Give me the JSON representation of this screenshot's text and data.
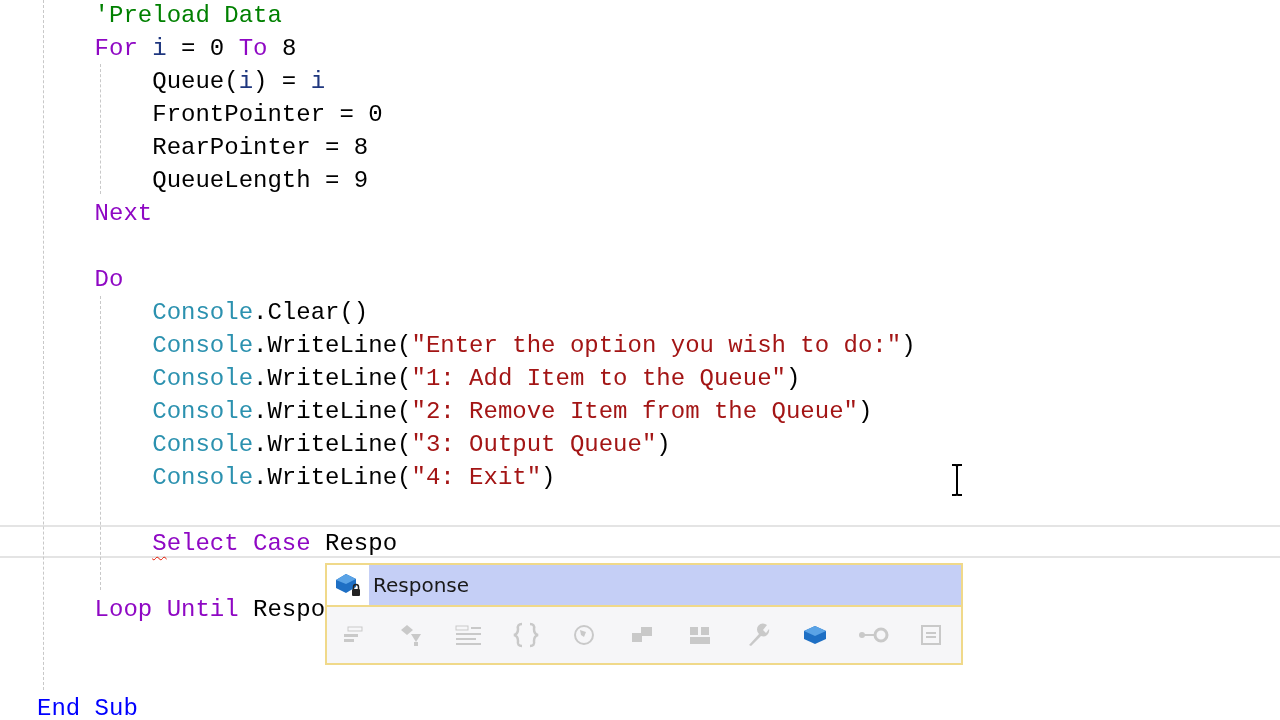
{
  "code_lines": [
    {
      "kind": "code",
      "current": false,
      "tokens": [
        {
          "text": "    'Preload Data",
          "kind": "comment"
        }
      ]
    },
    {
      "kind": "code",
      "current": false,
      "tokens": [
        {
          "text": "    For",
          "kind": "keyword"
        },
        {
          "text": " i",
          "kind": "local"
        },
        {
          "text": " = 0 ",
          "kind": "plain"
        },
        {
          "text": "To",
          "kind": "keyword"
        },
        {
          "text": " 8",
          "kind": "plain"
        }
      ]
    },
    {
      "kind": "code",
      "current": false,
      "tokens": [
        {
          "text": "        Queue(",
          "kind": "plain"
        },
        {
          "text": "i",
          "kind": "local"
        },
        {
          "text": ") = ",
          "kind": "plain"
        },
        {
          "text": "i",
          "kind": "local"
        }
      ]
    },
    {
      "kind": "code",
      "current": false,
      "tokens": [
        {
          "text": "        FrontPointer = 0",
          "kind": "plain"
        }
      ]
    },
    {
      "kind": "code",
      "current": false,
      "tokens": [
        {
          "text": "        RearPointer = 8",
          "kind": "plain"
        }
      ]
    },
    {
      "kind": "code",
      "current": false,
      "tokens": [
        {
          "text": "        QueueLength = 9",
          "kind": "plain"
        }
      ]
    },
    {
      "kind": "code",
      "current": false,
      "tokens": [
        {
          "text": "    Next",
          "kind": "keyword"
        }
      ]
    },
    {
      "kind": "blank"
    },
    {
      "kind": "code",
      "current": false,
      "tokens": [
        {
          "text": "    Do",
          "kind": "keyword"
        }
      ]
    },
    {
      "kind": "code",
      "current": false,
      "tokens": [
        {
          "text": "        Console",
          "kind": "type"
        },
        {
          "text": ".Clear()",
          "kind": "plain"
        }
      ]
    },
    {
      "kind": "code",
      "current": false,
      "tokens": [
        {
          "text": "        Console",
          "kind": "type"
        },
        {
          "text": ".WriteLine(",
          "kind": "plain"
        },
        {
          "text": "\"Enter the option you wish to do:\"",
          "kind": "string"
        },
        {
          "text": ")",
          "kind": "plain"
        }
      ]
    },
    {
      "kind": "code",
      "current": false,
      "tokens": [
        {
          "text": "        Console",
          "kind": "type"
        },
        {
          "text": ".WriteLine(",
          "kind": "plain"
        },
        {
          "text": "\"1: Add Item to the Queue\"",
          "kind": "string"
        },
        {
          "text": ")",
          "kind": "plain"
        }
      ]
    },
    {
      "kind": "code",
      "current": false,
      "tokens": [
        {
          "text": "        Console",
          "kind": "type"
        },
        {
          "text": ".WriteLine(",
          "kind": "plain"
        },
        {
          "text": "\"2: Remove Item from the Queue\"",
          "kind": "string"
        },
        {
          "text": ")",
          "kind": "plain"
        }
      ]
    },
    {
      "kind": "code",
      "current": false,
      "tokens": [
        {
          "text": "        Console",
          "kind": "type"
        },
        {
          "text": ".WriteLine(",
          "kind": "plain"
        },
        {
          "text": "\"3: Output Queue\"",
          "kind": "string"
        },
        {
          "text": ")",
          "kind": "plain"
        }
      ]
    },
    {
      "kind": "code",
      "current": false,
      "tokens": [
        {
          "text": "        Console",
          "kind": "type"
        },
        {
          "text": ".WriteLine(",
          "kind": "plain"
        },
        {
          "text": "\"4: Exit\"",
          "kind": "string"
        },
        {
          "text": ")",
          "kind": "plain"
        }
      ]
    },
    {
      "kind": "blank"
    },
    {
      "kind": "code",
      "current": true,
      "tokens": [
        {
          "text": "        Select Case",
          "kind": "keyword",
          "error": true
        },
        {
          "text": " Respo",
          "kind": "plain"
        }
      ]
    },
    {
      "kind": "blank"
    },
    {
      "kind": "code",
      "current": false,
      "tokens": [
        {
          "text": "    Loop Until",
          "kind": "keyword"
        },
        {
          "text": " Respo",
          "kind": "plain"
        }
      ]
    },
    {
      "kind": "blank"
    },
    {
      "kind": "blank"
    },
    {
      "kind": "code",
      "current": false,
      "tokens": [
        {
          "text": "End Sub",
          "kind": "declaration"
        }
      ]
    }
  ],
  "completion": {
    "items": [
      {
        "label": "Response",
        "selected": true
      }
    ],
    "filters": [
      {
        "kind": "snippet",
        "active": false
      },
      {
        "kind": "extension",
        "active": false
      },
      {
        "kind": "list",
        "active": false
      },
      {
        "kind": "braces",
        "active": false
      },
      {
        "kind": "globe",
        "active": false
      },
      {
        "kind": "squares",
        "active": false
      },
      {
        "kind": "blocks",
        "active": false
      },
      {
        "kind": "wrench",
        "active": false
      },
      {
        "kind": "cube",
        "active": true
      },
      {
        "kind": "key",
        "active": false
      },
      {
        "kind": "note",
        "active": false
      }
    ]
  }
}
